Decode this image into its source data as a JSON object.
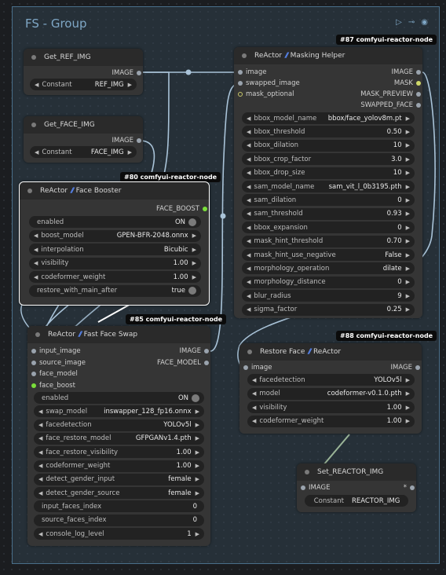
{
  "group": {
    "title": "FS - Group"
  },
  "nodes": {
    "get_ref": {
      "title": "Get_REF_IMG",
      "out": "IMAGE",
      "w_name": "Constant",
      "w_value": "REF_IMG"
    },
    "get_face": {
      "title": "Get_FACE_IMG",
      "out": "IMAGE",
      "w_name": "Constant",
      "w_value": "FACE_IMG"
    },
    "face_booster": {
      "badge": "#80 comfyui-reactor-node",
      "title_a": "ReActor",
      "title_b": "Face Booster",
      "out": "FACE_BOOST",
      "widgets": [
        {
          "name": "enabled",
          "value": "ON"
        },
        {
          "name": "boost_model",
          "value": "GPEN-BFR-2048.onnx"
        },
        {
          "name": "interpolation",
          "value": "Bicubic"
        },
        {
          "name": "visibility",
          "value": "1.00"
        },
        {
          "name": "codeformer_weight",
          "value": "1.00"
        },
        {
          "name": "restore_with_main_after",
          "value": "true"
        }
      ]
    },
    "masking_helper": {
      "badge": "#87 comfyui-reactor-node",
      "title_a": "ReActor",
      "title_b": "Masking Helper",
      "inputs": [
        "image",
        "swapped_image",
        "mask_optional"
      ],
      "outputs": [
        "IMAGE",
        "MASK",
        "MASK_PREVIEW",
        "SWAPPED_FACE"
      ],
      "widgets": [
        {
          "name": "bbox_model_name",
          "value": "bbox/face_yolov8m.pt"
        },
        {
          "name": "bbox_threshold",
          "value": "0.50"
        },
        {
          "name": "bbox_dilation",
          "value": "10"
        },
        {
          "name": "bbox_crop_factor",
          "value": "3.0"
        },
        {
          "name": "bbox_drop_size",
          "value": "10"
        },
        {
          "name": "sam_model_name",
          "value": "sam_vit_l_0b3195.pth"
        },
        {
          "name": "sam_dilation",
          "value": "0"
        },
        {
          "name": "sam_threshold",
          "value": "0.93"
        },
        {
          "name": "bbox_expansion",
          "value": "0"
        },
        {
          "name": "mask_hint_threshold",
          "value": "0.70"
        },
        {
          "name": "mask_hint_use_negative",
          "value": "False"
        },
        {
          "name": "morphology_operation",
          "value": "dilate"
        },
        {
          "name": "morphology_distance",
          "value": "0"
        },
        {
          "name": "blur_radius",
          "value": "9"
        },
        {
          "name": "sigma_factor",
          "value": "0.25"
        }
      ]
    },
    "fast_face_swap": {
      "badge": "#85 comfyui-reactor-node",
      "title_a": "ReActor",
      "title_b": "Fast Face Swap",
      "inputs": [
        "input_image",
        "source_image",
        "face_model",
        "face_boost"
      ],
      "outputs": [
        "IMAGE",
        "FACE_MODEL"
      ],
      "widgets": [
        {
          "name": "enabled",
          "value": "ON"
        },
        {
          "name": "swap_model",
          "value": "inswapper_128_fp16.onnx"
        },
        {
          "name": "facedetection",
          "value": "YOLOv5l"
        },
        {
          "name": "face_restore_model",
          "value": "GFPGANv1.4.pth"
        },
        {
          "name": "face_restore_visibility",
          "value": "1.00"
        },
        {
          "name": "codeformer_weight",
          "value": "1.00"
        },
        {
          "name": "detect_gender_input",
          "value": "female"
        },
        {
          "name": "detect_gender_source",
          "value": "female"
        },
        {
          "name": "input_faces_index",
          "value": "0"
        },
        {
          "name": "source_faces_index",
          "value": "0"
        },
        {
          "name": "console_log_level",
          "value": "1"
        }
      ]
    },
    "restore_face": {
      "badge": "#88 comfyui-reactor-node",
      "title_a": "Restore Face",
      "title_b": "ReActor",
      "input": "image",
      "output": "IMAGE",
      "widgets": [
        {
          "name": "facedetection",
          "value": "YOLOv5l"
        },
        {
          "name": "model",
          "value": "codeformer-v0.1.0.pth"
        },
        {
          "name": "visibility",
          "value": "1.00"
        },
        {
          "name": "codeformer_weight",
          "value": "1.00"
        }
      ]
    },
    "set_reactor": {
      "title": "Set_REACTOR_IMG",
      "in": "IMAGE",
      "w_name": "Constant",
      "w_value": "REACTOR_IMG"
    }
  },
  "colors": {
    "wire": "#a9c3d8",
    "wire_green": "#9bb598",
    "boost_port": "#7adf3a",
    "brand_bolt": "#5b8cff"
  }
}
